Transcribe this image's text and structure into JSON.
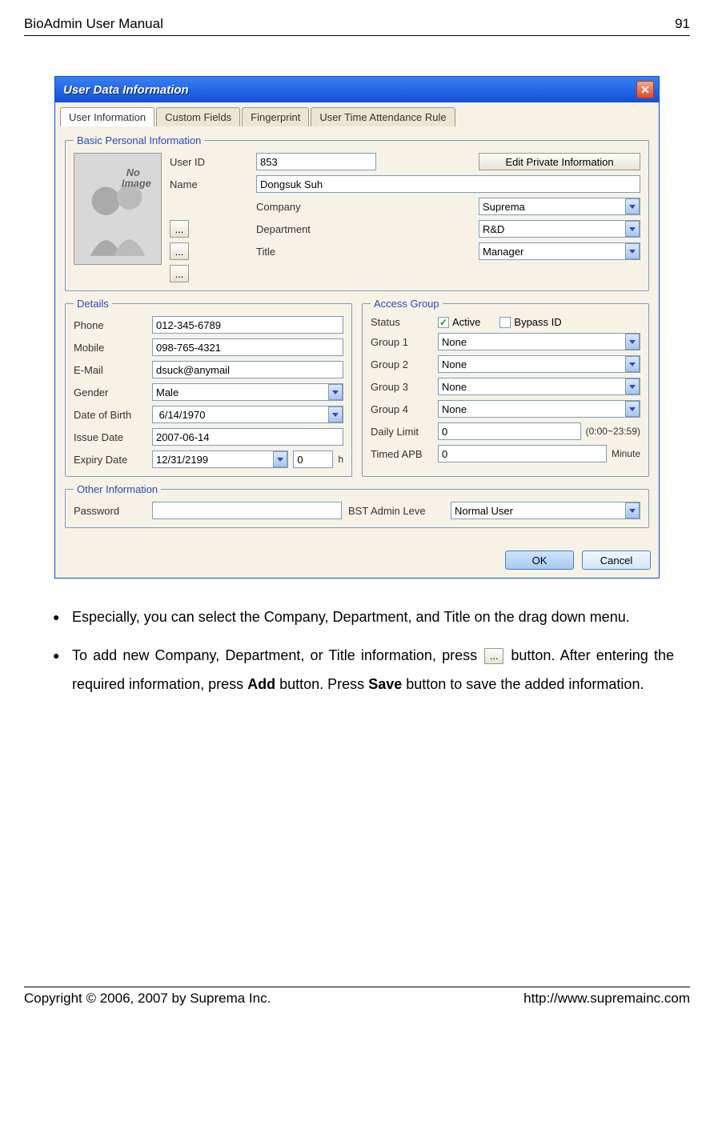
{
  "header": {
    "left": "BioAdmin User Manual",
    "right": "91"
  },
  "footer": {
    "left": "Copyright © 2006, 2007 by Suprema Inc.",
    "right": "http://www.supremainc.com"
  },
  "dialog": {
    "title": "User Data Information",
    "tabs": [
      "User Information",
      "Custom Fields",
      "Fingerprint",
      "User Time Attendance Rule"
    ],
    "active_tab": 0,
    "basic": {
      "legend": "Basic Personal Information",
      "photo_placeholder": "No Image",
      "user_id_label": "User ID",
      "user_id": "853",
      "edit_private": "Edit Private Information",
      "name_label": "Name",
      "name": "Dongsuk Suh",
      "company_label": "Company",
      "company": "Suprema",
      "department_label": "Department",
      "department": "R&D",
      "title_label": "Title",
      "title": "Manager",
      "ellipsis": "..."
    },
    "details": {
      "legend": "Details",
      "phone_label": "Phone",
      "phone": "012-345-6789",
      "mobile_label": "Mobile",
      "mobile": "098-765-4321",
      "email_label": "E-Mail",
      "email": "dsuck@anymail",
      "gender_label": "Gender",
      "gender": "Male",
      "dob_label": "Date of Birth",
      "dob": " 6/14/1970",
      "issue_label": "Issue Date",
      "issue": "2007-06-14",
      "expiry_label": "Expiry Date",
      "expiry_date": "12/31/2199",
      "expiry_hours": "0",
      "expiry_h": "h"
    },
    "access": {
      "legend": "Access Group",
      "status_label": "Status",
      "active_label": "Active",
      "active_checked": true,
      "bypass_label": "Bypass ID",
      "bypass_checked": false,
      "group1_label": "Group 1",
      "group1": "None",
      "group2_label": "Group 2",
      "group2": "None",
      "group3_label": "Group 3",
      "group3": "None",
      "group4_label": "Group 4",
      "group4": "None",
      "daily_limit_label": "Daily Limit",
      "daily_limit": "0",
      "daily_hint": "(0:00~23:59)",
      "timed_apb_label": "Timed APB",
      "timed_apb": "0",
      "timed_unit": "Minute"
    },
    "other": {
      "legend": "Other Information",
      "password_label": "Password",
      "password": "",
      "bst_label": "BST Admin Leve",
      "bst": "Normal User"
    },
    "buttons": {
      "ok": "OK",
      "cancel": "Cancel"
    }
  },
  "body_text": {
    "bullet1": "Especially, you can select the Company, Department, and Title on the drag down menu.",
    "bullet2a": "To add new Company, Department, or Title information, press ",
    "bullet2b": " button. After entering the required information, press ",
    "bullet2_bold1": "Add",
    "bullet2c": " button. Press ",
    "bullet2_bold2": "Save",
    "bullet2d": " button to save the added information.",
    "inline_ellipsis": "..."
  }
}
